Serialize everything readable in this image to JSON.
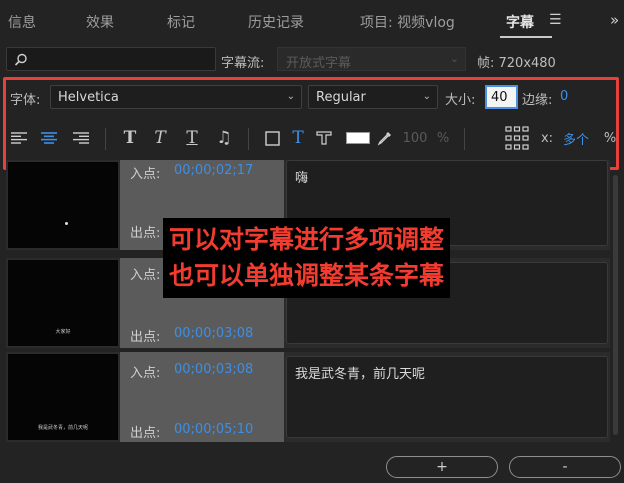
{
  "tabs": [
    {
      "label": "信息"
    },
    {
      "label": "效果"
    },
    {
      "label": "标记"
    },
    {
      "label": "历史记录"
    },
    {
      "label": "项目: 视频vlog"
    },
    {
      "label": "字幕",
      "active": true
    }
  ],
  "tab_menu_icon": "hamburger-icon",
  "tab_more_icon": "double-chevron-right-icon",
  "search": {
    "placeholder": ""
  },
  "caption_stream": {
    "label": "字幕流:",
    "value": "开放式字幕"
  },
  "frame": {
    "label": "帧: 720x480"
  },
  "font": {
    "label": "字体:",
    "family": "Helvetica",
    "style": "Regular",
    "size_label": "大小:",
    "size": "40",
    "edge_label": "边缘:",
    "edge": "0"
  },
  "toolbar": {
    "align_icons": [
      "align-left-icon",
      "align-center-icon",
      "align-right-icon"
    ],
    "style_icons": [
      "bold-t-icon",
      "italic-t-icon",
      "underline-t-icon",
      "music-note-icon"
    ],
    "bg_icons": [
      "background-box-icon",
      "text-color-t-icon",
      "outline-t-icon"
    ],
    "color_swatch": "#ffffff",
    "eyedropper_icon": "eyedropper-icon",
    "opacity": "100",
    "opacity_unit": "%",
    "position_grid_icon": "position-grid-icon",
    "x_label": "x:",
    "x_value": "多个",
    "x_unit": "%"
  },
  "captions": [
    {
      "in_label": "入点:",
      "in": "00;00;02;17",
      "out_label": "出点:",
      "out": "",
      "text": "嗨",
      "thumb_text": "",
      "dot": true
    },
    {
      "in_label": "入点:",
      "in": "",
      "out_label": "出点:",
      "out": "00;00;03;08",
      "text": "",
      "thumb_text": "大家好"
    },
    {
      "in_label": "入点:",
      "in": "00;00;03;08",
      "out_label": "出点:",
      "out": "00;00;05;10",
      "text": "我是武冬青，前几天呢",
      "thumb_text": "我是武冬青，前几天呢"
    }
  ],
  "overlay": {
    "line1": "可以对字幕进行多项调整",
    "line2": "也可以单独调整某条字幕"
  },
  "buttons": {
    "add": "+",
    "remove": "-"
  },
  "colors": {
    "accent": "#3d8fe6",
    "highlight": "#e8403a",
    "overlay_text": "#f23c2f"
  }
}
